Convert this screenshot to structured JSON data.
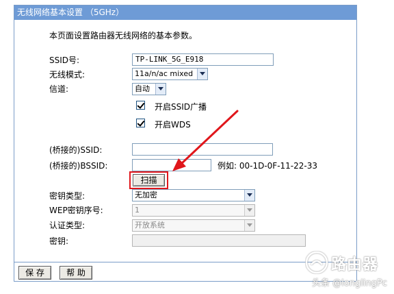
{
  "window": {
    "title": "无线网络基本设置 （5GHz）"
  },
  "intro": "本页面设置路由器无线网络的基本参数。",
  "fields": {
    "ssid_label": "SSID号:",
    "ssid_value": "TP-LINK_5G_E918",
    "mode_label": "无线模式:",
    "mode_value": "11a/n/ac mixed",
    "channel_label": "信道:",
    "channel_value": "自动",
    "broadcast_label": "开启SSID广播",
    "wds_label": "开启WDS",
    "bridge_ssid_label": "(桥接的)SSID:",
    "bridge_ssid_value": "",
    "bridge_bssid_label": "(桥接的)BSSID:",
    "bridge_bssid_value": "",
    "example_text": "例如: 00-1D-0F-11-22-33",
    "scan_label": "扫描",
    "key_type_label": "密钥类型:",
    "key_type_value": "无加密",
    "wep_index_label": "WEP密钥序号:",
    "wep_index_value": "1",
    "auth_type_label": "认证类型:",
    "auth_type_value": "开放系统",
    "key_label": "密钥:",
    "key_value": ""
  },
  "buttons": {
    "save": "保 存",
    "help": "帮 助"
  },
  "watermark": {
    "logo_text": "路由器",
    "credit": "头条 @longlingPc"
  },
  "colors": {
    "title_bar": "#6e9bd6",
    "highlight": "#e0161b",
    "arrow": "#e0161b"
  },
  "icons": {
    "arrow": "red-arrow-annotation",
    "checkbox": "checked-checkbox"
  }
}
